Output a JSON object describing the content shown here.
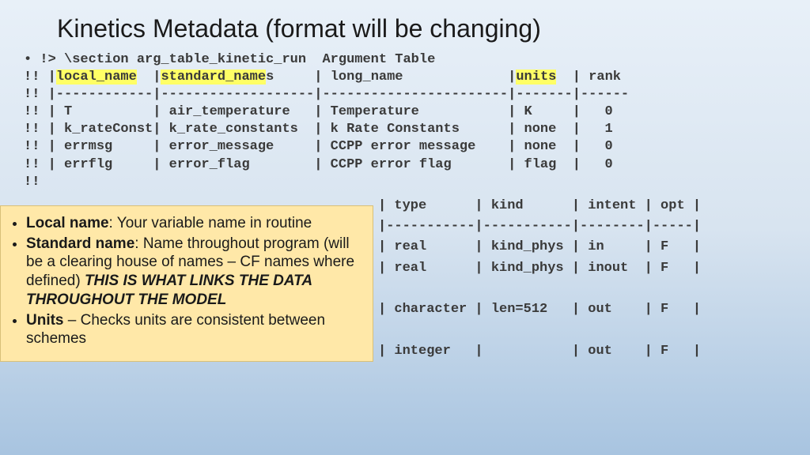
{
  "title": "Kinetics Metadata (format will be changing)",
  "code": {
    "section_line": "!> \\section arg_table_kinetic_run  Argument Table",
    "header_prefix": "!! |",
    "hl_local": "local_name",
    "header_mid1": "  |",
    "hl_standard": "standard_name",
    "header_mid2": "s     | long_name             |",
    "hl_units": "units",
    "header_suffix": "  | rank",
    "sep": "!! |------------|-------------------|-----------------------|-------|------",
    "row1": "!! | T          | air_temperature   | Temperature           | K     |   0",
    "row2": "!! | k_rateConst| k_rate_constants  | k Rate Constants      | none  |   1",
    "row3": "!! | errmsg     | error_message     | CCPP error message    | none  |   0",
    "row4": "!! | errflg     | error_flag        | CCPP error flag       | flag  |   0",
    "trailing": "!!"
  },
  "callout": {
    "local_bold": "Local name",
    "local_text": ": Your variable name in routine",
    "std_bold": "Standard name",
    "std_text1": ": Name throughout program (will be a clearing house of names – CF names where defined) ",
    "std_emph": "THIS IS WHAT LINKS THE DATA THROUGHOUT THE MODEL",
    "units_bold": "Units",
    "units_text": " – Checks units are consistent between schemes"
  },
  "right_table": {
    "header": "| type      | kind      | intent | opt |",
    "sep": "|-----------|-----------|--------|-----|",
    "r1": "| real      | kind_phys | in     | F   |",
    "r2": "| real      | kind_phys | inout  | F   |",
    "blank": "",
    "r3": "| character | len=512   | out    | F   |",
    "blank2": "",
    "r4": "| integer   |           | out    | F   |"
  }
}
